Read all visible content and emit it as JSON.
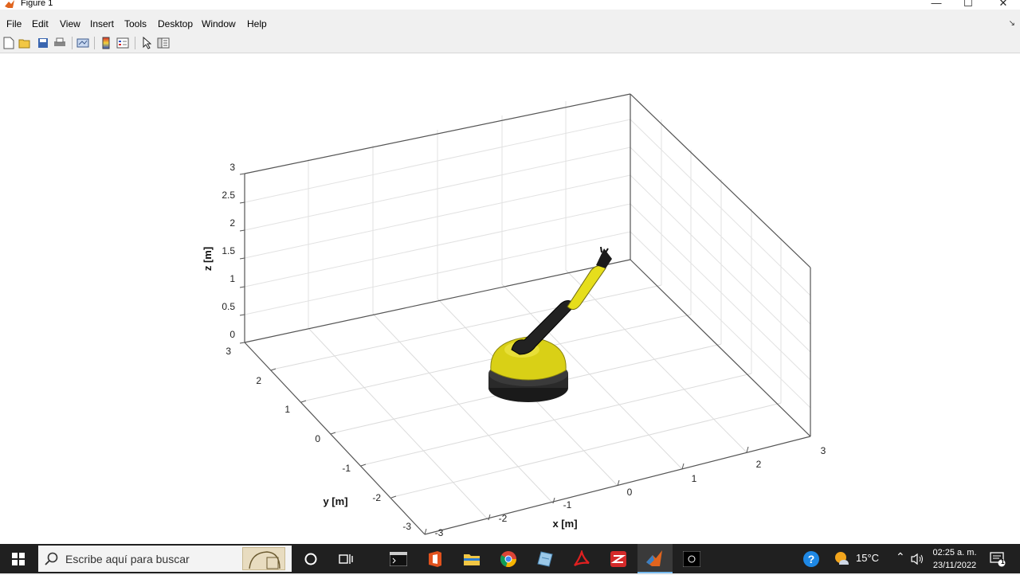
{
  "window": {
    "title": "Figure 1"
  },
  "menu": [
    "File",
    "Edit",
    "View",
    "Insert",
    "Tools",
    "Desktop",
    "Window",
    "Help"
  ],
  "toolbar": [
    "new-figure-icon",
    "open-file-icon",
    "save-icon",
    "print-icon",
    "link-plot-icon",
    "colorbar-icon",
    "legend-icon",
    "edit-plot-icon",
    "property-inspector-icon"
  ],
  "axes": {
    "xlabel": "x [m]",
    "ylabel": "y [m]",
    "zlabel": "z [m]",
    "x_ticks": [
      "-3",
      "-2",
      "-1",
      "0",
      "1",
      "2",
      "3"
    ],
    "y_ticks": [
      "-3",
      "-2",
      "-1",
      "0",
      "1",
      "2",
      "3"
    ],
    "z_ticks": [
      "0",
      "0.5",
      "1",
      "1.5",
      "2",
      "2.5",
      "3"
    ],
    "xlim": [
      -3,
      3
    ],
    "ylim": [
      -3,
      3
    ],
    "zlim": [
      0,
      3
    ],
    "grid": true,
    "robot_color": "#e6de1c",
    "base_color": "#1a1a1a"
  },
  "taskbar": {
    "search_placeholder": "Escribe aquí para buscar",
    "temperature": "15°C",
    "time": "02:25 a. m.",
    "date": "23/11/2022",
    "notification_count": "1"
  }
}
